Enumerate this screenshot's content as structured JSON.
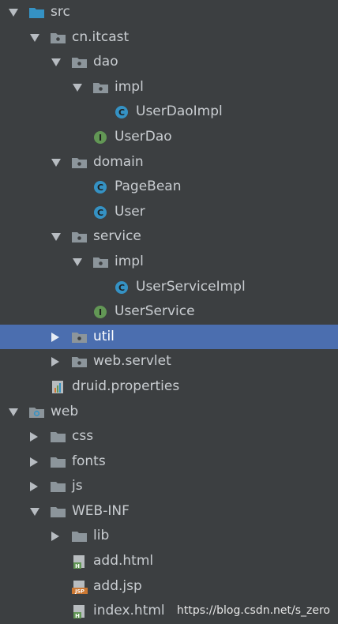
{
  "tree": [
    {
      "label": "src",
      "level": 0,
      "expander": "down",
      "icon": "source-folder-icon"
    },
    {
      "label": "cn.itcast",
      "level": 1,
      "expander": "down",
      "icon": "package-icon"
    },
    {
      "label": "dao",
      "level": 2,
      "expander": "down",
      "icon": "package-icon"
    },
    {
      "label": "impl",
      "level": 3,
      "expander": "down",
      "icon": "package-icon"
    },
    {
      "label": "UserDaoImpl",
      "level": 4,
      "expander": "none",
      "icon": "class-icon"
    },
    {
      "label": "UserDao",
      "level": 3,
      "expander": "none",
      "icon": "interface-icon"
    },
    {
      "label": "domain",
      "level": 2,
      "expander": "down",
      "icon": "package-icon"
    },
    {
      "label": "PageBean",
      "level": 3,
      "expander": "none",
      "icon": "class-icon"
    },
    {
      "label": "User",
      "level": 3,
      "expander": "none",
      "icon": "class-icon"
    },
    {
      "label": "service",
      "level": 2,
      "expander": "down",
      "icon": "package-icon"
    },
    {
      "label": "impl",
      "level": 3,
      "expander": "down",
      "icon": "package-icon"
    },
    {
      "label": "UserServiceImpl",
      "level": 4,
      "expander": "none",
      "icon": "class-icon"
    },
    {
      "label": "UserService",
      "level": 3,
      "expander": "none",
      "icon": "interface-icon"
    },
    {
      "label": "util",
      "level": 2,
      "expander": "right",
      "icon": "package-icon",
      "selected": true
    },
    {
      "label": "web.servlet",
      "level": 2,
      "expander": "right",
      "icon": "package-icon"
    },
    {
      "label": "druid.properties",
      "level": 1,
      "expander": "none",
      "icon": "properties-file-icon"
    },
    {
      "label": "web",
      "level": 0,
      "expander": "down",
      "icon": "web-module-icon"
    },
    {
      "label": "css",
      "level": 1,
      "expander": "right",
      "icon": "folder-icon"
    },
    {
      "label": "fonts",
      "level": 1,
      "expander": "right",
      "icon": "folder-icon"
    },
    {
      "label": "js",
      "level": 1,
      "expander": "right",
      "icon": "folder-icon"
    },
    {
      "label": "WEB-INF",
      "level": 1,
      "expander": "down",
      "icon": "folder-icon"
    },
    {
      "label": "lib",
      "level": 2,
      "expander": "right",
      "icon": "folder-icon"
    },
    {
      "label": "add.html",
      "level": 2,
      "expander": "none",
      "icon": "html-file-icon"
    },
    {
      "label": "add.jsp",
      "level": 2,
      "expander": "none",
      "icon": "jsp-file-icon"
    },
    {
      "label": "index.html",
      "level": 2,
      "expander": "none",
      "icon": "html-file-icon"
    }
  ],
  "watermark": "https://blog.csdn.net/s_zero",
  "colors": {
    "background": "#3c3f41",
    "selection": "#4b6eaf",
    "folder": "#8c959b",
    "source_folder": "#3592c4",
    "class": "#3592c4",
    "interface": "#629755",
    "html": "#629755",
    "jsp": "#cc7832"
  }
}
